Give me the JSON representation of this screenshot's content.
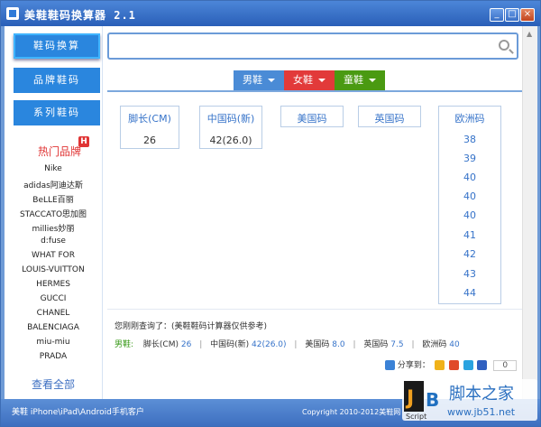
{
  "window": {
    "title": "美鞋鞋码换算器 2.1"
  },
  "sidebar": {
    "buttons": [
      "鞋码换算",
      "品牌鞋码",
      "系列鞋码"
    ],
    "hot_title": "热门品牌",
    "hot_badge": "H",
    "brands": [
      "Nike",
      "adidas阿迪达斯",
      "BeLLE百丽",
      "STACCATO思加图",
      "millies妙丽",
      "d:fuse",
      "WHAT FOR",
      "LOUIS-VUITTON",
      "HERMES",
      "GUCCI",
      "CHANEL",
      "BALENCIAGA",
      "miu-miu",
      "PRADA"
    ],
    "view_all": "查看全部"
  },
  "search": {
    "placeholder": ""
  },
  "tabs": [
    {
      "label": "男鞋",
      "color": "#4a8bd6"
    },
    {
      "label": "女鞋",
      "color": "#e23a3a"
    },
    {
      "label": "童鞋",
      "color": "#4a9a12"
    }
  ],
  "sizes": {
    "foot_length_label": "脚长(CM)",
    "foot_length_value": "26",
    "china_label": "中国码(新)",
    "china_value": "42(26.0)",
    "us_label": "美国码",
    "uk_label": "英国码",
    "eu_label": "欧洲码",
    "eu_values": [
      "38",
      "39",
      "40",
      "40",
      "40",
      "41",
      "42",
      "43",
      "44"
    ]
  },
  "result": {
    "query_text": "您刚刚查询了：(美鞋鞋码计算器仅供参考)",
    "sex": "男鞋:",
    "foot_label": "脚长(CM)",
    "foot_value": "26",
    "china_label": "中国码(新)",
    "china_value": "42(26.0)",
    "us_label": "美国码",
    "us_value": "8.0",
    "uk_label": "英国码",
    "uk_value": "7.5",
    "eu_label": "欧洲码",
    "eu_value": "40"
  },
  "share": {
    "label": "分享到：",
    "count": "0"
  },
  "status": {
    "left": "美鞋 iPhone\\iPad\\Android手机客户",
    "right": "Copyright 2010-2012美鞋网",
    "script": "Script"
  },
  "watermark": {
    "text1": "脚本之家",
    "text2": "www.jb51.net"
  }
}
